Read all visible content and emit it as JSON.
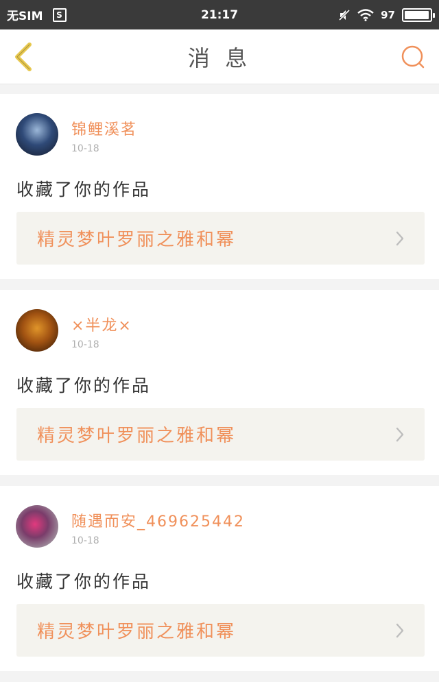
{
  "status_bar": {
    "sim": "无SIM",
    "sim_icon_glyph": "S",
    "time": "21:17",
    "battery_text": "97",
    "battery_level": 0.97
  },
  "header": {
    "title": "消 息",
    "accent_color": "#f0905a",
    "back_icon_color": "#e7c84e"
  },
  "messages": [
    {
      "username": "锦鲤溪茗",
      "date": "10-18",
      "action": "收藏了你的作品",
      "work_title": "精灵梦叶罗丽之雅和幂"
    },
    {
      "username": "×半龙×",
      "date": "10-18",
      "action": "收藏了你的作品",
      "work_title": "精灵梦叶罗丽之雅和幂"
    },
    {
      "username": "随遇而安_469625442",
      "date": "10-18",
      "action": "收藏了你的作品",
      "work_title": "精灵梦叶罗丽之雅和幂"
    }
  ]
}
